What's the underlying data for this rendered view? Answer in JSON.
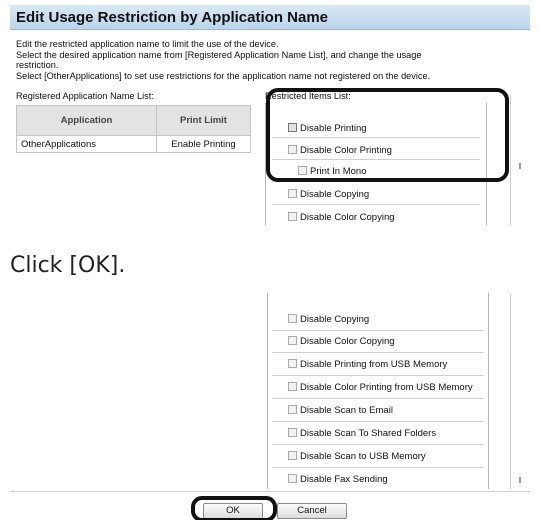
{
  "dialog": {
    "title": "Edit Usage Restriction by Application Name",
    "description": [
      "Edit the restricted application name to limit the use of the device.",
      "Select the desired application name from [Registered Application Name List], and change the usage",
      "restriction.",
      "Select [OtherApplications] to set use restrictions for the application name not registered on the device."
    ],
    "registered_list_label": "Registered Application Name List:",
    "restricted_list_label": "Restricted Items List:",
    "table": {
      "headers": [
        "Application",
        "Print Limit"
      ],
      "rows": [
        [
          "OtherApplications",
          "Enable Printing"
        ]
      ]
    },
    "restricted_items_top": [
      {
        "label": "Disable Printing",
        "checked": false
      },
      {
        "label": "Disable Color Printing",
        "checked": false
      },
      {
        "label": "Print In Mono",
        "checked": false
      },
      {
        "label": "Disable Copying",
        "checked": false
      },
      {
        "label": "Disable Color Copying",
        "checked": false
      }
    ]
  },
  "instruction": "Click [OK].",
  "dialog_bottom": {
    "restricted_items": [
      {
        "label": "Disable Copying",
        "checked": false
      },
      {
        "label": "Disable Color Copying",
        "checked": false
      },
      {
        "label": "Disable Printing from USB Memory",
        "checked": false
      },
      {
        "label": "Disable Color Printing from USB Memory",
        "checked": false
      },
      {
        "label": "Disable Scan to Email",
        "checked": false
      },
      {
        "label": "Disable Scan To Shared Folders",
        "checked": false
      },
      {
        "label": "Disable Scan to USB Memory",
        "checked": false
      },
      {
        "label": "Disable Fax Sending",
        "checked": false
      }
    ],
    "ok_label": "OK",
    "cancel_label": "Cancel"
  },
  "colors": {
    "title_bar": "#c6dcee",
    "highlight": "#111111"
  }
}
